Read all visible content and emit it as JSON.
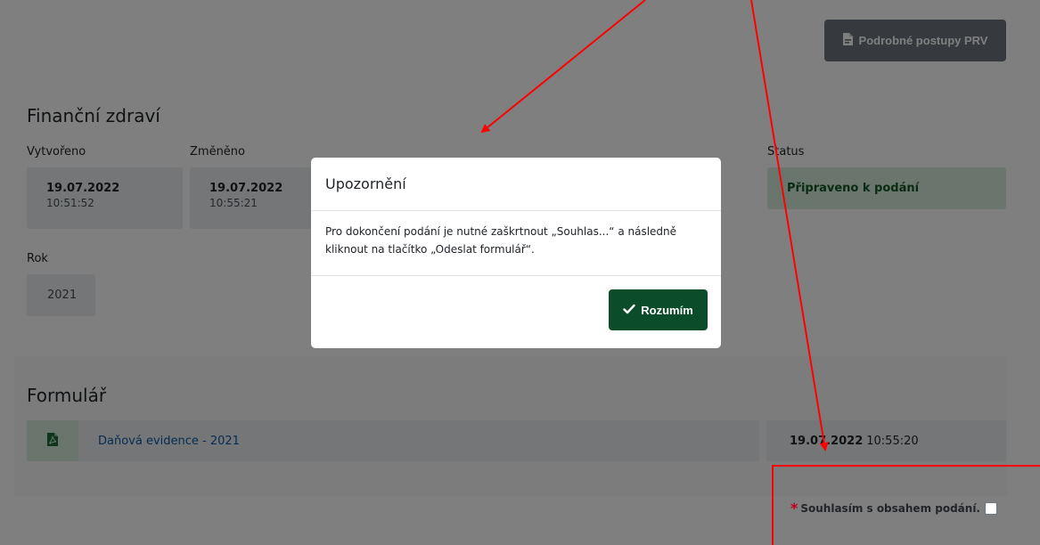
{
  "header": {
    "prv_button_label": "Podrobné postupy PRV"
  },
  "detail": {
    "title": "Finanční zdraví",
    "created_label": "Vytvořeno",
    "created_date": "19.07.2022",
    "created_time": "10:51:52",
    "changed_label": "Změněno",
    "changed_date": "19.07.2022",
    "changed_time": "10:55:21",
    "status_label": "Status",
    "status_value": "Připraveno k podání",
    "year_label": "Rok",
    "year_value": "2021"
  },
  "form": {
    "title": "Formulář",
    "file_name": "Daňová evidence - 2021",
    "file_date": "19.07.2022",
    "file_time": "10:55:20",
    "consent_required_mark": "*",
    "consent_label": "Souhlasím s obsahem podání.",
    "consent_checked": false
  },
  "modal": {
    "title": "Upozornění",
    "body_line1": "Pro dokončení podání je nutné zaškrtnout „Souhlas...“ a následně",
    "body_line2": "kliknout na tlačítko „Odeslat formulář“.",
    "ok_label": "Rozumím"
  },
  "colors": {
    "success_dark": "#0b4d2a",
    "status_bg": "#d4edda",
    "annotation_red": "#ff0000",
    "required_red": "#c0001e"
  },
  "icons": {
    "prv_button": "pdf-file-icon",
    "file_row": "pdf-file-icon",
    "ok_button": "check-icon"
  }
}
